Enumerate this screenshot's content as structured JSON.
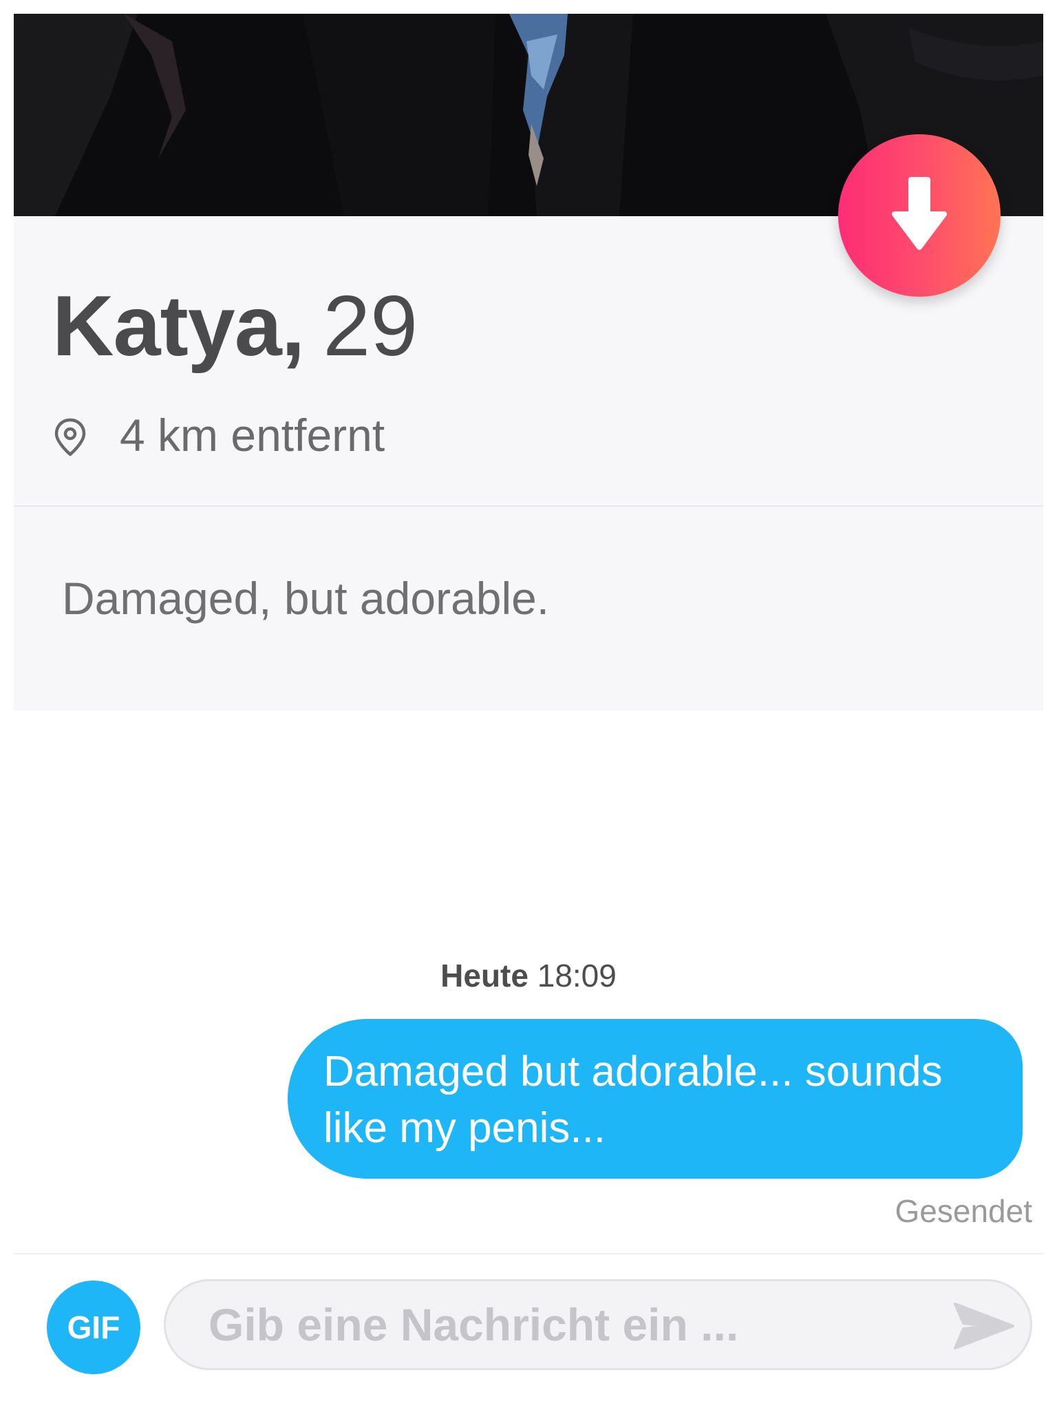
{
  "profile": {
    "name": "Katya",
    "comma": ",",
    "age": "29",
    "distance": "4 km entfernt",
    "bio": "Damaged, but adorable."
  },
  "conversation": {
    "timestamp_day": "Heute",
    "timestamp_time": "18:09",
    "messages": [
      {
        "direction": "outgoing",
        "text": "Damaged but adorable... sounds like my penis..."
      }
    ],
    "status": "Gesendet"
  },
  "composer": {
    "gif_label": "GIF",
    "placeholder": "Gib eine Nachricht ein ..."
  },
  "icons": {
    "collapse": "arrow-down-icon",
    "location": "location-pin-icon",
    "send": "send-icon"
  },
  "colors": {
    "accent_gradient_start": "#fd2d77",
    "accent_gradient_end": "#ff7454",
    "bubble": "#1fb6f7",
    "card_background": "#f7f7f9"
  }
}
